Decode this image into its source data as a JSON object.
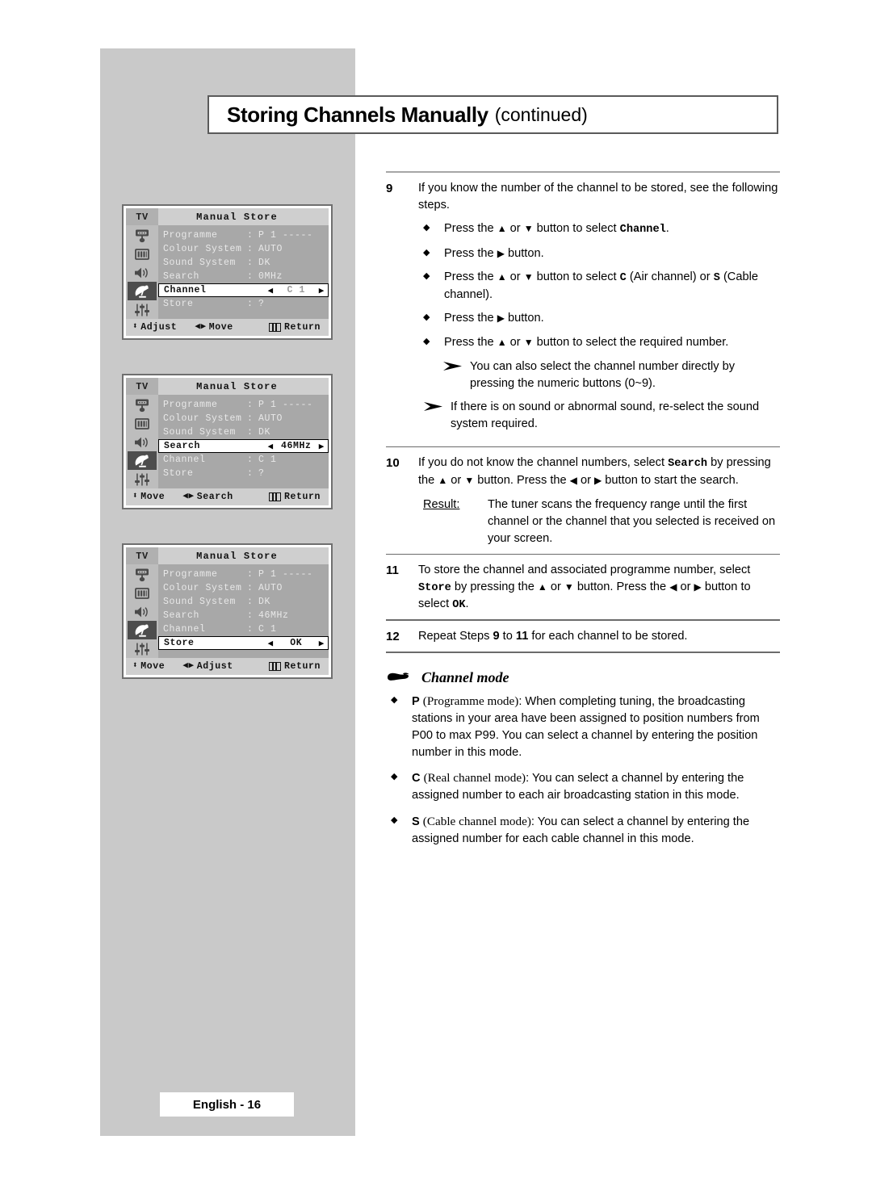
{
  "page": {
    "title_main": "Storing Channels Manually",
    "title_sub": "(continued)",
    "footer_label": "English - 16"
  },
  "osd_panels": [
    {
      "tv_label": "TV",
      "menu_title": "Manual Store",
      "rows": [
        {
          "label": "Programme",
          "sep": ":",
          "value": "P 1 -----",
          "highlighted": false
        },
        {
          "label": "Colour System",
          "sep": ":",
          "value": "AUTO",
          "highlighted": false
        },
        {
          "label": "Sound System",
          "sep": ":",
          "value": "DK",
          "highlighted": false
        },
        {
          "label": "Search",
          "sep": ":",
          "value": "0MHz",
          "highlighted": false
        },
        {
          "label": "Channel",
          "sep": "",
          "value": "C 1",
          "highlighted": true,
          "dim_value": true
        },
        {
          "label": "Store",
          "sep": ":",
          "value": "?",
          "highlighted": false
        }
      ],
      "footer": [
        {
          "icon": "up-down-arrow-icon",
          "glyph": "⬍",
          "label": "Adjust"
        },
        {
          "icon": "left-right-arrow-icon",
          "glyph": "◀▶",
          "label": "Move"
        },
        {
          "icon": "menu-bars-icon",
          "glyph": "bars",
          "label": "Return"
        }
      ],
      "rail_icons": [
        {
          "name": "picture-monitor-icon",
          "selected": false
        },
        {
          "name": "picture-bars-icon",
          "selected": false
        },
        {
          "name": "sound-speaker-icon",
          "selected": false
        },
        {
          "name": "channel-satellite-dish-icon",
          "selected": true
        },
        {
          "name": "setup-sliders-icon",
          "selected": false
        }
      ]
    },
    {
      "tv_label": "TV",
      "menu_title": "Manual Store",
      "rows": [
        {
          "label": "Programme",
          "sep": ":",
          "value": "P 1 -----",
          "highlighted": false
        },
        {
          "label": "Colour System",
          "sep": ":",
          "value": "AUTO",
          "highlighted": false
        },
        {
          "label": "Sound System",
          "sep": ":",
          "value": "DK",
          "highlighted": false
        },
        {
          "label": "Search",
          "sep": "",
          "value": "46MHz",
          "highlighted": true,
          "dim_value": false
        },
        {
          "label": "Channel",
          "sep": ":",
          "value": "C 1",
          "highlighted": false
        },
        {
          "label": "Store",
          "sep": ":",
          "value": "?",
          "highlighted": false
        }
      ],
      "footer": [
        {
          "icon": "up-down-arrow-icon",
          "glyph": "⬍",
          "label": "Move"
        },
        {
          "icon": "left-right-arrow-icon",
          "glyph": "◀▶",
          "label": "Search"
        },
        {
          "icon": "menu-bars-icon",
          "glyph": "bars",
          "label": "Return"
        }
      ],
      "rail_icons": [
        {
          "name": "picture-monitor-icon",
          "selected": false
        },
        {
          "name": "picture-bars-icon",
          "selected": false
        },
        {
          "name": "sound-speaker-icon",
          "selected": false
        },
        {
          "name": "channel-satellite-dish-icon",
          "selected": true
        },
        {
          "name": "setup-sliders-icon",
          "selected": false
        }
      ]
    },
    {
      "tv_label": "TV",
      "menu_title": "Manual Store",
      "rows": [
        {
          "label": "Programme",
          "sep": ":",
          "value": "P 1 -----",
          "highlighted": false
        },
        {
          "label": "Colour System",
          "sep": ":",
          "value": "AUTO",
          "highlighted": false
        },
        {
          "label": "Sound System",
          "sep": ":",
          "value": "DK",
          "highlighted": false
        },
        {
          "label": "Search",
          "sep": ":",
          "value": "46MHz",
          "highlighted": false
        },
        {
          "label": "Channel",
          "sep": ":",
          "value": "C 1",
          "highlighted": false
        },
        {
          "label": "Store",
          "sep": "",
          "value": "OK",
          "highlighted": true,
          "dim_value": false
        }
      ],
      "footer": [
        {
          "icon": "up-down-arrow-icon",
          "glyph": "⬍",
          "label": "Move"
        },
        {
          "icon": "left-right-arrow-icon",
          "glyph": "◀▶",
          "label": "Adjust"
        },
        {
          "icon": "menu-bars-icon",
          "glyph": "bars",
          "label": "Return"
        }
      ],
      "rail_icons": [
        {
          "name": "picture-monitor-icon",
          "selected": false
        },
        {
          "name": "picture-bars-icon",
          "selected": false
        },
        {
          "name": "sound-speaker-icon",
          "selected": false
        },
        {
          "name": "channel-satellite-dish-icon",
          "selected": true
        },
        {
          "name": "setup-sliders-icon",
          "selected": false
        }
      ]
    }
  ],
  "steps": {
    "step9": {
      "num": "9",
      "text": "If you know the number of the channel to be stored, see the following steps.",
      "bullets": [
        "Press the ▲ or ▼ button to select Channel.",
        "Press the ▶ button.",
        "Press the ▲ or ▼ button to select C (Air channel) or S (Cable channel).",
        "Press the ▶ button.",
        "Press the ▲ or ▼ button to select the required number."
      ],
      "note1": "You can also select the channel number directly by pressing the numeric buttons (0~9).",
      "note2": "If there is on sound or abnormal sound, re-select the sound system required."
    },
    "step10": {
      "num": "10",
      "text": "If you do not know the channel numbers, select Search by pressing the ▲ or ▼ button. Press the ◀ or ▶ button to start the search.",
      "result_label": "Result:",
      "result_text": "The tuner scans the frequency range until the first channel or the channel that you selected is received on your screen."
    },
    "step11": {
      "num": "11",
      "text": "To store the channel and associated programme number, select Store by pressing the ▲ or ▼ button. Press the ◀ or ▶ button to select OK."
    },
    "step12": {
      "num": "12",
      "text": "Repeat Steps 9 to 11 for each channel to be stored."
    }
  },
  "channel_mode": {
    "heading": "Channel mode",
    "items": [
      {
        "key": "P",
        "paren": "(Programme mode)",
        "body": ": When completing tuning, the broadcasting stations in your area have been assigned to position numbers from P00 to max P99. You can select a channel by entering the position number in this mode."
      },
      {
        "key": "C",
        "paren": "(Real channel mode)",
        "body": ": You can select a channel by entering the assigned number to each air broadcasting station in this mode."
      },
      {
        "key": "S",
        "paren": "(Cable channel mode)",
        "body": ": You can select a channel by entering the assigned number for each cable channel in this mode."
      }
    ]
  }
}
